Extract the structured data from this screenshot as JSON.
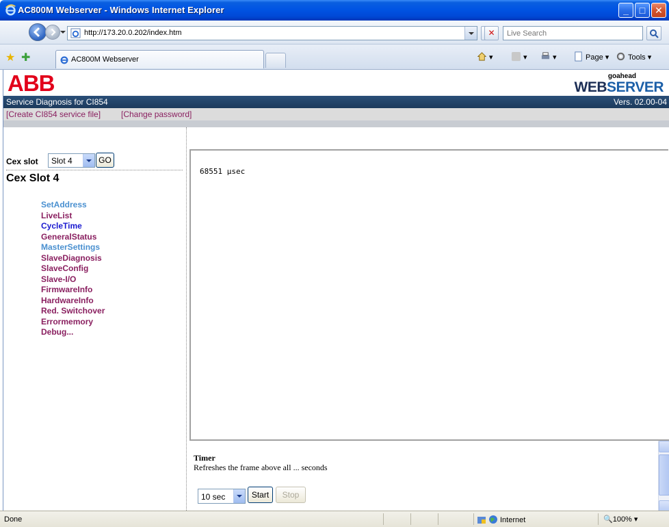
{
  "window": {
    "title": "AC800M Webserver - Windows Internet Explorer",
    "controls": {
      "minimize": "_",
      "maximize": "□",
      "close": "✕"
    }
  },
  "address_bar": {
    "url": "http://173.20.0.202/index.htm",
    "search_placeholder": "Live Search"
  },
  "tabs": {
    "active_label": "AC800M Webserver"
  },
  "command_bar": {
    "page_label": "Page",
    "tools_label": "Tools"
  },
  "header": {
    "logo_text": "ABB",
    "server_small": "goahead",
    "server_web": "WEB",
    "server_server": "SERVER",
    "service_title": "Service Diagnosis for CI854",
    "version": "Vers. 02.00-04",
    "link_create": "[Create CI854 service file]",
    "link_password": "[Change password]"
  },
  "sidebar": {
    "cex_label": "Cex slot",
    "slot_value": "Slot 4",
    "go_label": "GO",
    "heading": "Cex Slot 4",
    "items": [
      {
        "label": "SetAddress",
        "color": "#4a90d0"
      },
      {
        "label": "LiveList",
        "color": "#8a2060"
      },
      {
        "label": "CycleTime",
        "color": "#1a1ad0"
      },
      {
        "label": "GeneralStatus",
        "color": "#8a2060"
      },
      {
        "label": "MasterSettings",
        "color": "#4a90d0"
      },
      {
        "label": "SlaveDiagnosis",
        "color": "#8a2060"
      },
      {
        "label": "SlaveConfig",
        "color": "#8a2060"
      },
      {
        "label": "Slave-I/O",
        "color": "#8a2060"
      },
      {
        "label": "FirmwareInfo",
        "color": "#8a2060"
      },
      {
        "label": "HardwareInfo",
        "color": "#8a2060"
      },
      {
        "label": "Red. Switchover",
        "color": "#8a2060"
      },
      {
        "label": "Errormemory",
        "color": "#8a2060"
      },
      {
        "label": "Debug...",
        "color": "#8a2060"
      }
    ]
  },
  "main": {
    "output_text": "68551 µsec"
  },
  "timer": {
    "title": "Timer",
    "description": "Refreshes the frame above all ... seconds",
    "interval_value": "10 sec",
    "start_label": "Start",
    "stop_label": "Stop"
  },
  "status_bar": {
    "status_text": "Done",
    "zone_text": "Internet",
    "zoom_text": "100%"
  },
  "colors": {
    "title_bar": "#0054e3",
    "abb_red": "#e2001a",
    "header_band": "#1c3a5c",
    "link_color": "#8a2060"
  }
}
